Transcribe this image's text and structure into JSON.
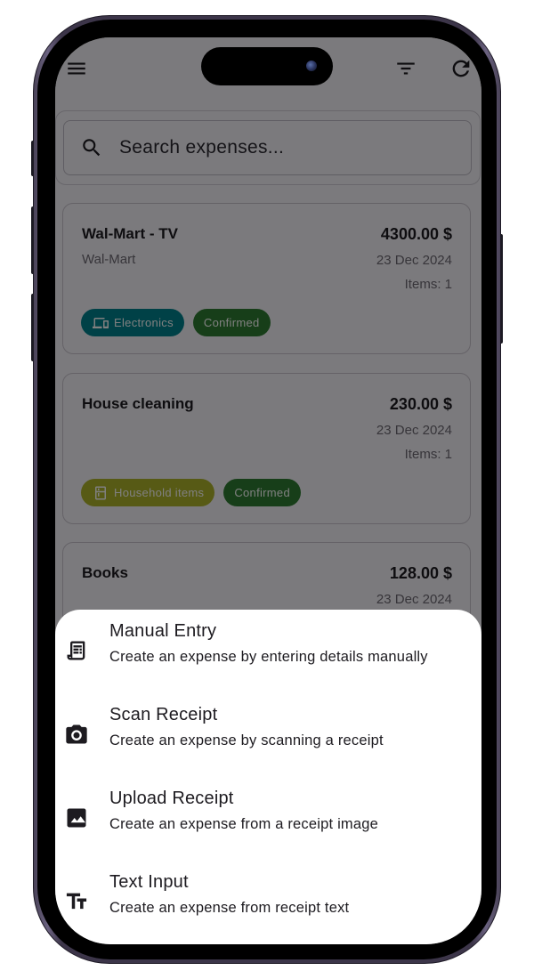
{
  "appbar": {
    "menu_icon": "menu-icon",
    "filter_icon": "filter-icon",
    "refresh_icon": "refresh-icon"
  },
  "search": {
    "placeholder": "Search expenses...",
    "value": "",
    "icon": "search-icon"
  },
  "expenses": [
    {
      "title": "Wal-Mart - TV",
      "merchant": "Wal-Mart",
      "amount": "4300.00 $",
      "date": "23 Dec 2024",
      "items": "Items: 1",
      "category": {
        "label": "Electronics",
        "icon": "devices-icon",
        "color": "#00838f"
      },
      "status": {
        "label": "Confirmed",
        "color": "#2e7d32"
      }
    },
    {
      "title": "House cleaning",
      "merchant": "",
      "amount": "230.00 $",
      "date": "23 Dec 2024",
      "items": "Items: 1",
      "category": {
        "label": "Household items",
        "icon": "fridge-icon",
        "color": "#afb42b"
      },
      "status": {
        "label": "Confirmed",
        "color": "#2e7d32"
      }
    },
    {
      "title": "Books",
      "merchant": "",
      "amount": "128.00 $",
      "date": "23 Dec 2024"
    }
  ],
  "bottom_sheet": {
    "options": [
      {
        "title": "Manual Entry",
        "subtitle": "Create an expense by entering details manually",
        "icon": "receipt-icon"
      },
      {
        "title": "Scan Receipt",
        "subtitle": "Create an expense by scanning a receipt",
        "icon": "camera-icon"
      },
      {
        "title": "Upload Receipt",
        "subtitle": "Create an expense from a receipt image",
        "icon": "image-icon"
      },
      {
        "title": "Text Input",
        "subtitle": "Create an expense from receipt text",
        "icon": "text-fields-icon"
      }
    ]
  },
  "colors": {
    "scrim": "#000000",
    "sheet_bg": "#ffffff",
    "electronics_chip": "#00838f",
    "household_chip": "#afb42b",
    "confirmed_chip": "#2e7d32",
    "frame": "#3c3549"
  }
}
